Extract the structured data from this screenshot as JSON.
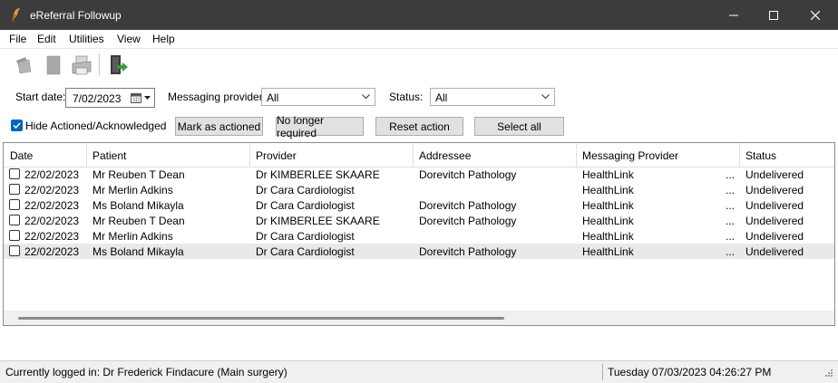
{
  "window": {
    "title": "eReferral Followup"
  },
  "menu": {
    "items": [
      "File",
      "Edit",
      "Utilities",
      "View",
      "Help"
    ]
  },
  "filters": {
    "start_date_label": "Start date:",
    "start_date_value": "7/02/2023",
    "messaging_provider_label": "Messaging provider:",
    "messaging_provider_value": "All",
    "status_label": "Status:",
    "status_value": "All",
    "hide_actioned_label": "Hide Actioned/Acknowledged",
    "hide_actioned_checked": true
  },
  "actions": {
    "mark_actioned": "Mark as actioned",
    "no_longer_required": "No longer required",
    "reset_action": "Reset action",
    "select_all": "Select all"
  },
  "grid": {
    "columns": [
      "Date",
      "Patient",
      "Provider",
      "Addressee",
      "Messaging Provider",
      "Status"
    ],
    "rows": [
      {
        "date": "22/02/2023",
        "patient": "Mr Reuben T Dean",
        "provider": "Dr KIMBERLEE SKAARE",
        "addressee": "Dorevitch Pathology",
        "messaging": "HealthLink",
        "ellipsis": "...",
        "status": "Undelivered"
      },
      {
        "date": "22/02/2023",
        "patient": "Mr Merlin Adkins",
        "provider": "Dr Cara Cardiologist",
        "addressee": "",
        "messaging": "HealthLink",
        "ellipsis": "...",
        "status": "Undelivered"
      },
      {
        "date": "22/02/2023",
        "patient": "Ms Boland Mikayla",
        "provider": "Dr Cara Cardiologist",
        "addressee": "Dorevitch Pathology",
        "messaging": "HealthLink",
        "ellipsis": "...",
        "status": "Undelivered"
      },
      {
        "date": "22/02/2023",
        "patient": "Mr Reuben T Dean",
        "provider": "Dr KIMBERLEE SKAARE",
        "addressee": "Dorevitch Pathology",
        "messaging": "HealthLink",
        "ellipsis": "...",
        "status": "Undelivered"
      },
      {
        "date": "22/02/2023",
        "patient": "Mr Merlin Adkins",
        "provider": "Dr Cara Cardiologist",
        "addressee": "",
        "messaging": "HealthLink",
        "ellipsis": "...",
        "status": "Undelivered"
      },
      {
        "date": "22/02/2023",
        "patient": "Ms Boland Mikayla",
        "provider": "Dr Cara Cardiologist",
        "addressee": "Dorevitch Pathology",
        "messaging": "HealthLink",
        "ellipsis": "...",
        "status": "Undelivered"
      }
    ]
  },
  "statusbar": {
    "logged_in": "Currently logged in:  Dr Frederick Findacure (Main surgery)",
    "datetime": "Tuesday 07/03/2023 04:26:27 PM"
  },
  "colors": {
    "titlebar": "#3c3c3c",
    "accent": "#0067c0",
    "selected_row": "#e9e9e9"
  }
}
